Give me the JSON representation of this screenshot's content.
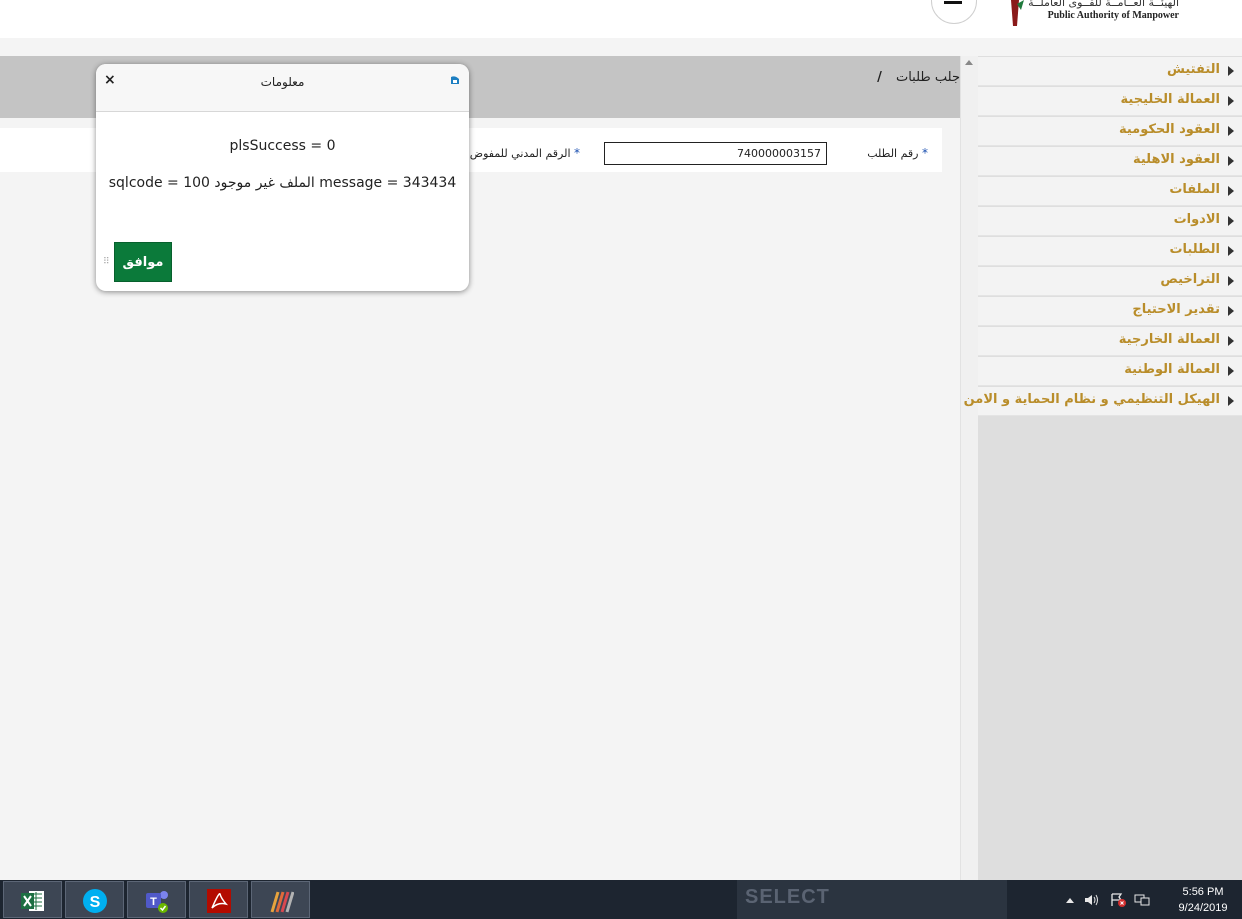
{
  "header": {
    "org_name_ar": "الهيئــة العــامــة للقــوى العاملــة",
    "org_name_en": "Public Authority of Manpower"
  },
  "page": {
    "breadcrumb_title": "جلب طلبات",
    "breadcrumb_separator": "/"
  },
  "form": {
    "request_no_label": "رقم الطلب",
    "request_no_value": "740000003157",
    "civil_id_label": "الرقم المدني للمفوض",
    "required_mark": "*"
  },
  "sidebar": {
    "items": [
      {
        "label": "التفتيش"
      },
      {
        "label": "العمالة الخليجية"
      },
      {
        "label": "العقود الحكومية"
      },
      {
        "label": "العقود الاهلية"
      },
      {
        "label": "الملفات"
      },
      {
        "label": "الادوات"
      },
      {
        "label": "الطلبات"
      },
      {
        "label": "التراخيص"
      },
      {
        "label": "تقدير الاحتياج"
      },
      {
        "label": "العمالة الخارجية"
      },
      {
        "label": "العمالة الوطنية"
      },
      {
        "label": "الهيكل التنظيمي و نظام الحماية و الامن"
      }
    ]
  },
  "dialog": {
    "title": "معلومات",
    "close_label": "×",
    "line1": "plsSuccess = 0",
    "line2": "sqlcode = 100 الملف غير موجود message = 343434",
    "ok_label": "موافق"
  },
  "taskbar": {
    "apps": [
      {
        "icon": "excel-icon"
      },
      {
        "icon": "skype-icon"
      },
      {
        "icon": "teams-icon"
      },
      {
        "icon": "acrobat-icon"
      },
      {
        "icon": "app-icon"
      }
    ],
    "ghost_text": "SELECT",
    "time": "5:56 PM",
    "date": "9/24/2019"
  },
  "colors": {
    "accent_gold": "#b98d2a",
    "ok_green": "#0b7a3a",
    "taskbar_bg": "#1d2530"
  }
}
